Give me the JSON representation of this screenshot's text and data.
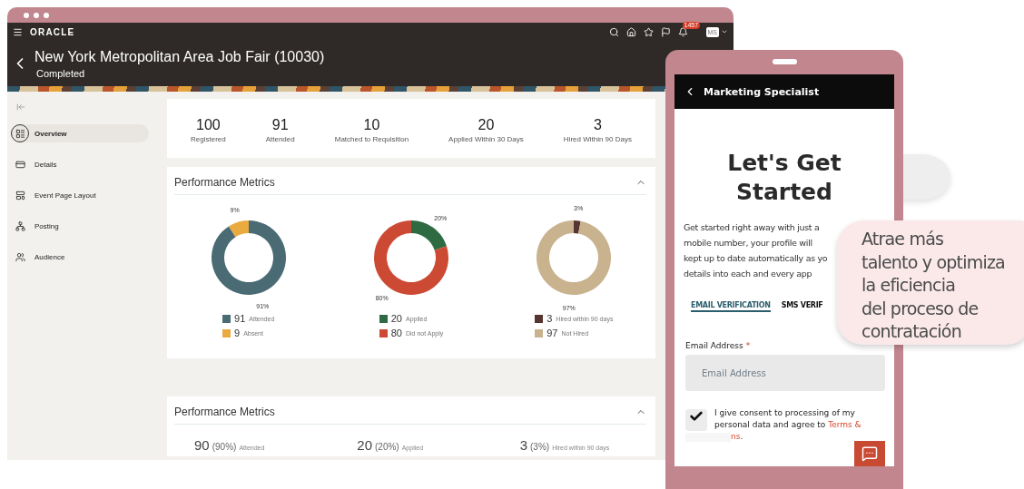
{
  "browser": {
    "header": {
      "logo": "ORACLE",
      "notification_count": "1457",
      "avatar": "MS"
    },
    "page": {
      "title": "New York Metropolitan Area Job Fair (10030)",
      "status": "Completed"
    },
    "sidebar": {
      "items": [
        {
          "label": "Overview",
          "selected": true
        },
        {
          "label": "Details",
          "selected": false
        },
        {
          "label": "Event Page Layout",
          "selected": false
        },
        {
          "label": "Posting",
          "selected": false
        },
        {
          "label": "Audience",
          "selected": false
        }
      ]
    },
    "stats": [
      {
        "value": "100",
        "label": "Registered"
      },
      {
        "value": "91",
        "label": "Attended"
      },
      {
        "value": "10",
        "label": "Matched to Requisition"
      },
      {
        "value": "20",
        "label": "Applied Within 30 Days"
      },
      {
        "value": "3",
        "label": "Hired Within 90 Days"
      }
    ],
    "metrics_panels": [
      {
        "title": "Performance Metrics",
        "expanded": true,
        "charts": [
          {
            "legend": [
              {
                "value": "91",
                "color": "#4a6b74"
              },
              {
                "value": "9",
                "color": "#e9aa3f"
              }
            ],
            "chart_data": {
              "type": "donut",
              "categories": [
                "Attended",
                "Absent"
              ],
              "series": [
                {
                  "values": [
                    91,
                    9
                  ]
                }
              ],
              "value_labels": [
                "91%",
                "9%"
              ]
            }
          },
          {
            "legend": [
              {
                "value": "20",
                "color": "#2e6a42"
              },
              {
                "value": "80",
                "color": "#cc4a34"
              }
            ],
            "chart_data": {
              "type": "donut",
              "categories": [
                "Applied",
                "Did not Apply"
              ],
              "series": [
                {
                  "values": [
                    20,
                    80
                  ]
                }
              ],
              "value_labels": [
                "20%",
                "80%"
              ]
            }
          },
          {
            "legend": [
              {
                "value": "3",
                "color": "#563530"
              },
              {
                "value": "97",
                "color": "#c9b28e"
              }
            ],
            "chart_data": {
              "type": "donut",
              "categories": [
                "Hired within 90 days",
                "Not Hired"
              ],
              "series": [
                {
                  "values": [
                    3,
                    97
                  ]
                }
              ],
              "value_labels": [
                "3%",
                "97%"
              ]
            }
          }
        ]
      },
      {
        "title": "Performance Metrics",
        "expanded": true,
        "summary": [
          {
            "count": "90",
            "percent": "(90%)",
            "caption": "Attended"
          },
          {
            "count": "20",
            "percent": "(20%)",
            "caption": "Applied"
          },
          {
            "count": "3",
            "percent": "(3%)",
            "caption": "Hired within 90 days"
          }
        ]
      }
    ]
  },
  "phone": {
    "title": "Marketing Specialist",
    "heading": "Let's Get Started",
    "intro_lines": [
      "Get started right away with just a",
      "mobile number, your profile will",
      "kept up to date automatically as yo",
      "details into each and every app"
    ],
    "tabs": [
      {
        "label": "EMAIL VERIFICATION",
        "selected": true
      },
      {
        "label": "SMS VERIF",
        "selected": false
      }
    ],
    "email_field": {
      "label": "Email Address",
      "required_mark": "*",
      "placeholder": "Email Address"
    },
    "consent": {
      "checked": true,
      "text": "I give consent to processing of my personal data and agree to",
      "link": "Terms &",
      "link_tail": "ns",
      "end": "."
    }
  },
  "callout": {
    "lines": [
      "Atrae más",
      "talento y optimiza",
      "la eficiencia",
      "del proceso de",
      "contratación"
    ]
  }
}
